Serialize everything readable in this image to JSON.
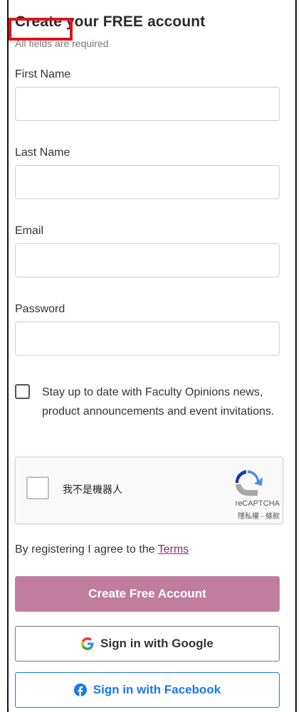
{
  "form": {
    "title": "Create your FREE account",
    "subtitle": "All fields are required",
    "fields": [
      {
        "label": "First Name",
        "value": "",
        "placeholder": ""
      },
      {
        "label": "Last Name",
        "value": "",
        "placeholder": ""
      },
      {
        "label": "Email",
        "value": "",
        "placeholder": ""
      },
      {
        "label": "Password",
        "value": "",
        "placeholder": ""
      }
    ],
    "optin": {
      "checked": false,
      "text": "Stay up to date with Faculty Opinions news, product announcements and event invitations."
    },
    "recaptcha": {
      "label": "我不是機器人",
      "brand": "reCAPTCHA",
      "privacy_terms": "隱私權 - 條款"
    },
    "terms": {
      "prefix": "By registering I agree to the ",
      "link": "Terms"
    },
    "buttons": {
      "create": "Create Free Account",
      "google": "Sign in with Google",
      "facebook": "Sign in with Facebook"
    }
  },
  "colors": {
    "primary_button": "#c07d9e",
    "terms_link": "#8e2d5e",
    "facebook_blue": "#1877f2",
    "highlight_box": "#e1121a"
  },
  "icons": [
    "google-icon",
    "facebook-icon",
    "recaptcha-logo-icon"
  ]
}
